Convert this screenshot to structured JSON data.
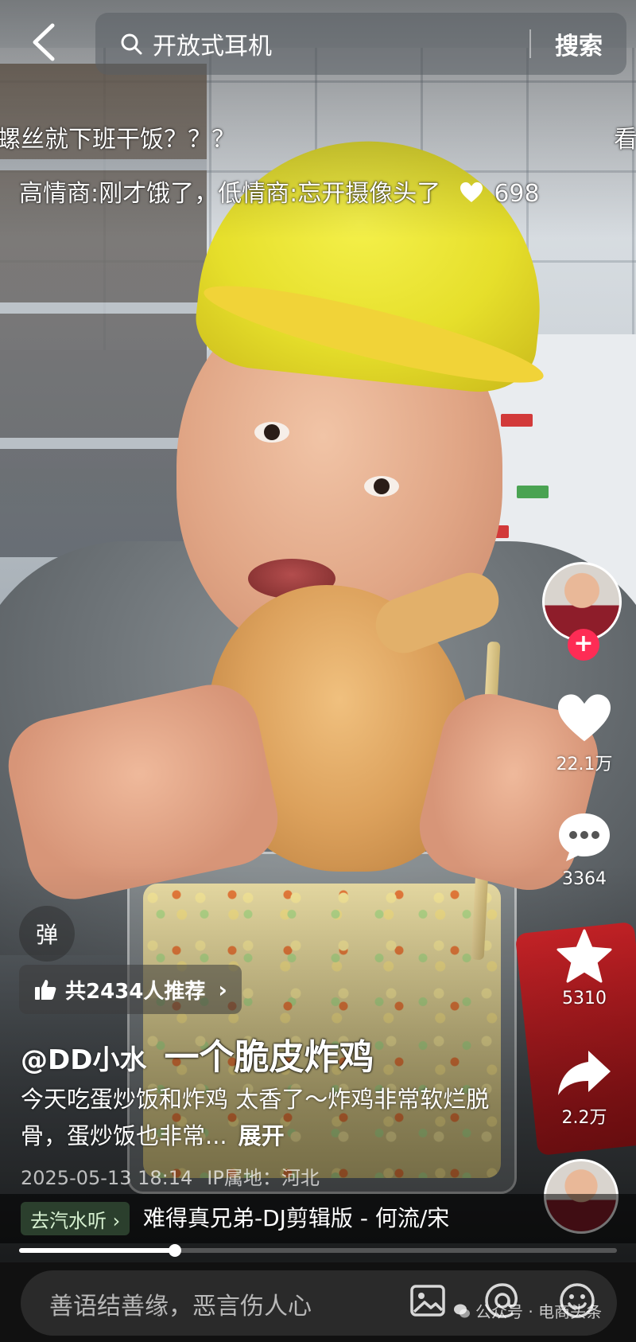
{
  "search": {
    "query": "开放式耳机",
    "button_label": "搜索"
  },
  "danmaku": [
    {
      "text": "螺丝就下班干饭？？？",
      "likes": ""
    },
    {
      "text": "看",
      "likes": ""
    },
    {
      "text": "高情商:刚才饿了，低情商:忘开摄像头了",
      "likes": "698"
    }
  ],
  "actions": {
    "like_count": "22.1万",
    "comment_count": "3364",
    "favorite_count": "5310",
    "share_count": "2.2万"
  },
  "follow_plus": "+",
  "danmu_toggle_label": "弹",
  "recommend": {
    "label": "共2434人推荐",
    "chevron": "›"
  },
  "post": {
    "author": "@DD小水",
    "caption_title": "一个脆皮炸鸡",
    "description": "今天吃蛋炒饭和炸鸡 太香了～炸鸡非常软烂脱骨，蛋炒饭也非常...",
    "expand_label": "展开",
    "datetime": "2025-05-13 18:14",
    "ip_location": "IP属地：河北"
  },
  "music": {
    "chip_label": "去汽水听 ›",
    "title": "难得真兄弟-DJ剪辑版 - 何流/宋"
  },
  "progress": {
    "played_fraction": 0.26
  },
  "comment": {
    "placeholder": "善语结善缘，恶言伤人心"
  },
  "watermark": "公众号 · 电商头条",
  "icons": {
    "back": "back-arrow-icon",
    "search": "search-icon",
    "like": "heart-icon",
    "comment": "comment-bubble-icon",
    "favorite": "star-icon",
    "share": "share-arrow-icon",
    "thumb": "thumbs-up-icon",
    "image": "image-icon",
    "mention": "at-icon",
    "emoji": "emoji-icon"
  },
  "colors": {
    "accent": "#fe2c55",
    "music_chip_bg": "#2b3f2d"
  }
}
